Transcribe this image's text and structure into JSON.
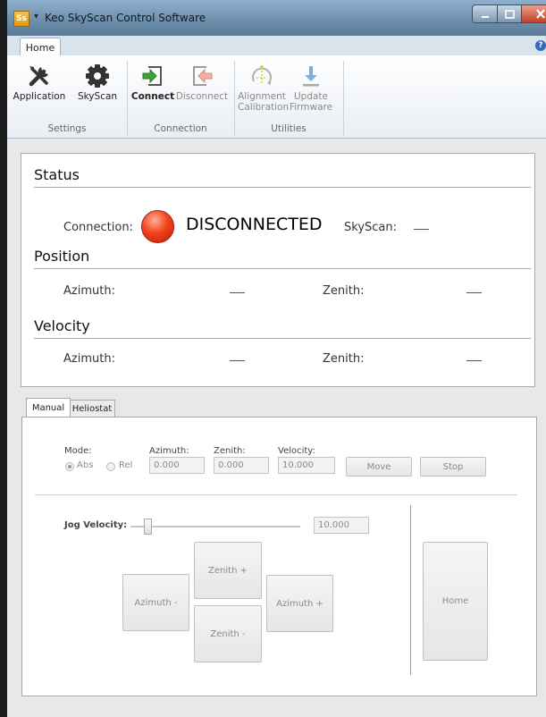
{
  "window": {
    "app_icon": "Ss",
    "title": "Keo SkyScan Control Software",
    "controls": {
      "minimize": "minimize-icon",
      "maximize": "maximize-icon",
      "close": "close-icon"
    }
  },
  "ribbon": {
    "tab_home": "Home",
    "groups": {
      "settings": {
        "label": "Settings",
        "application": "Application",
        "skyscan": "SkyScan"
      },
      "connection": {
        "label": "Connection",
        "connect": "Connect",
        "disconnect": "Disconnect"
      },
      "utilities": {
        "label": "Utilities",
        "alignment_line1": "Alignment",
        "alignment_line2": "Calibration",
        "update_line1": "Update",
        "update_line2": "Firmware"
      }
    }
  },
  "status": {
    "title": "Status",
    "connection_label": "Connection:",
    "connection_value": "DISCONNECTED",
    "indicator_color": "#e8361a",
    "skyscan_label": "SkyScan:"
  },
  "position": {
    "title": "Position",
    "azimuth_label": "Azimuth:",
    "zenith_label": "Zenith:"
  },
  "velocity": {
    "title": "Velocity",
    "azimuth_label": "Azimuth:",
    "zenith_label": "Zenith:"
  },
  "tabs": {
    "manual": "Manual",
    "heliostat": "Heliostat"
  },
  "manual": {
    "mode_label": "Mode:",
    "abs": "Abs",
    "rel": "Rel",
    "azimuth_label": "Azimuth:",
    "azimuth_value": "0.000",
    "zenith_label": "Zenith:",
    "zenith_value": "0.000",
    "velocity_label": "Velocity:",
    "velocity_value": "10.000",
    "move": "Move",
    "stop": "Stop",
    "jog_label": "Jog Velocity:",
    "jog_value": "10.000",
    "zenith_plus": "Zenith +",
    "zenith_minus": "Zenith -",
    "azimuth_minus": "Azimuth -",
    "azimuth_plus": "Azimuth +",
    "home": "Home"
  }
}
